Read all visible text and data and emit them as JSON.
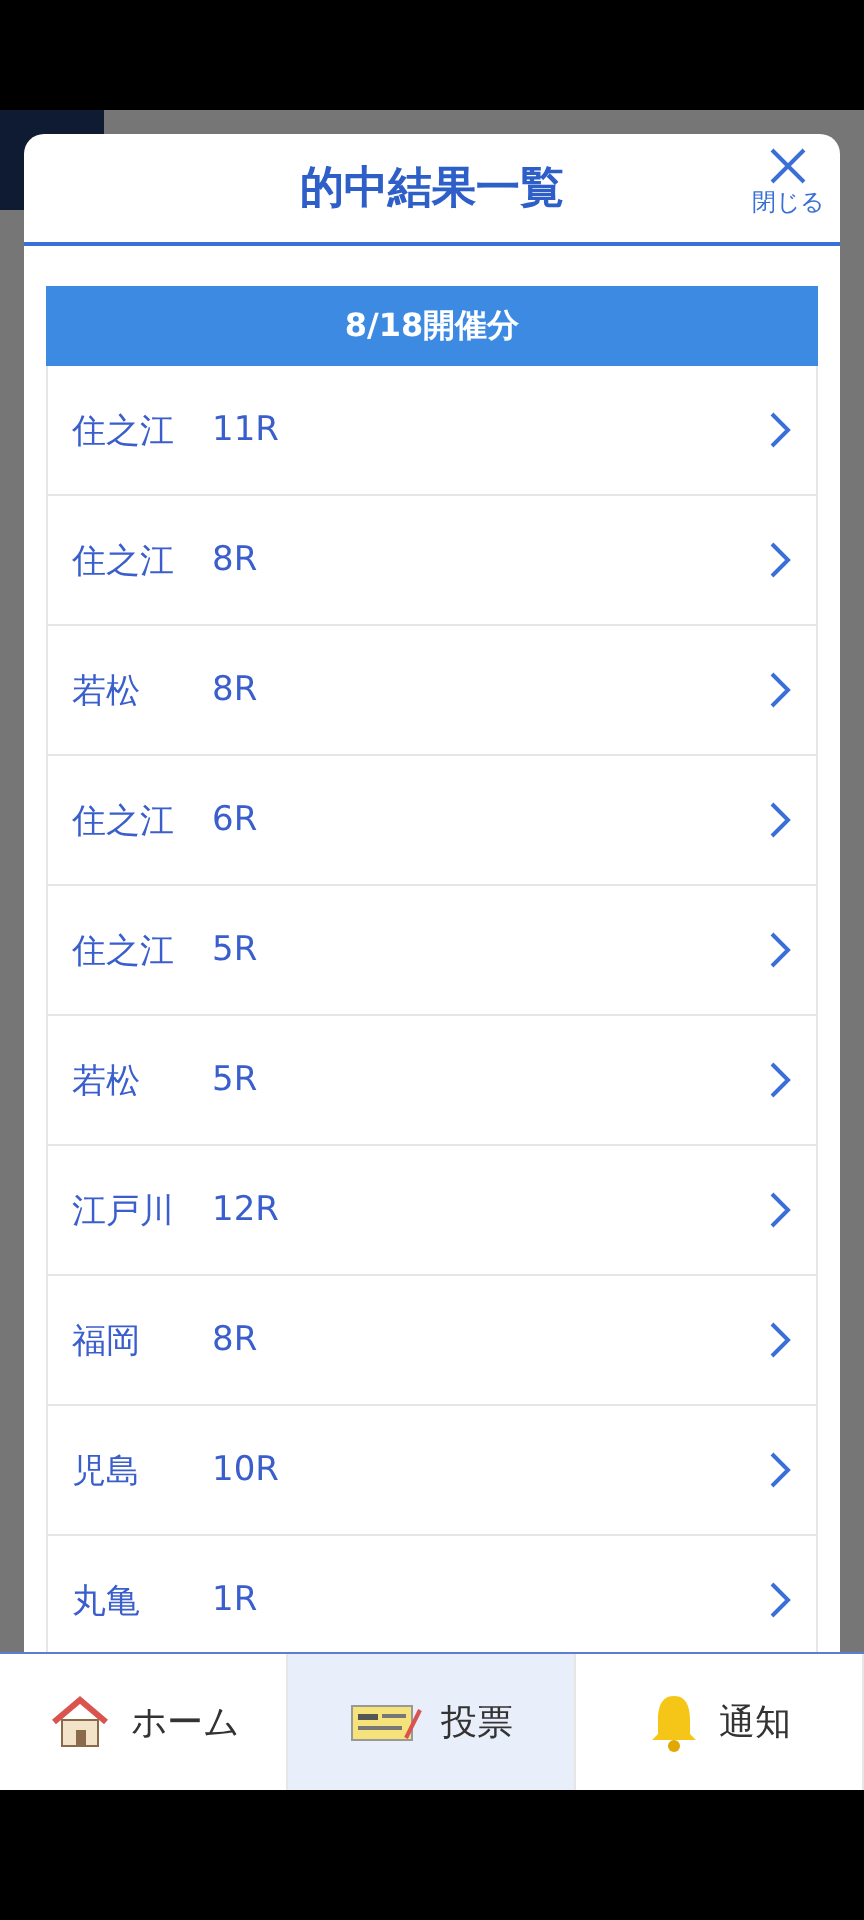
{
  "modal": {
    "title": "的中結果一覧",
    "close_label": "閉じる",
    "section": "8/18開催分",
    "rows": [
      {
        "venue": "住之江",
        "race": "11R"
      },
      {
        "venue": "住之江",
        "race": "8R"
      },
      {
        "venue": "若松",
        "race": "8R"
      },
      {
        "venue": "住之江",
        "race": "6R"
      },
      {
        "venue": "住之江",
        "race": "5R"
      },
      {
        "venue": "若松",
        "race": "5R"
      },
      {
        "venue": "江戸川",
        "race": "12R"
      },
      {
        "venue": "福岡",
        "race": "8R"
      },
      {
        "venue": "児島",
        "race": "10R"
      },
      {
        "venue": "丸亀",
        "race": "1R"
      }
    ]
  },
  "nav": [
    {
      "kind": "home",
      "label": "ホーム",
      "selected": false
    },
    {
      "kind": "ticket",
      "label": "投票",
      "selected": true
    },
    {
      "kind": "bell",
      "label": "通知",
      "selected": false
    }
  ]
}
